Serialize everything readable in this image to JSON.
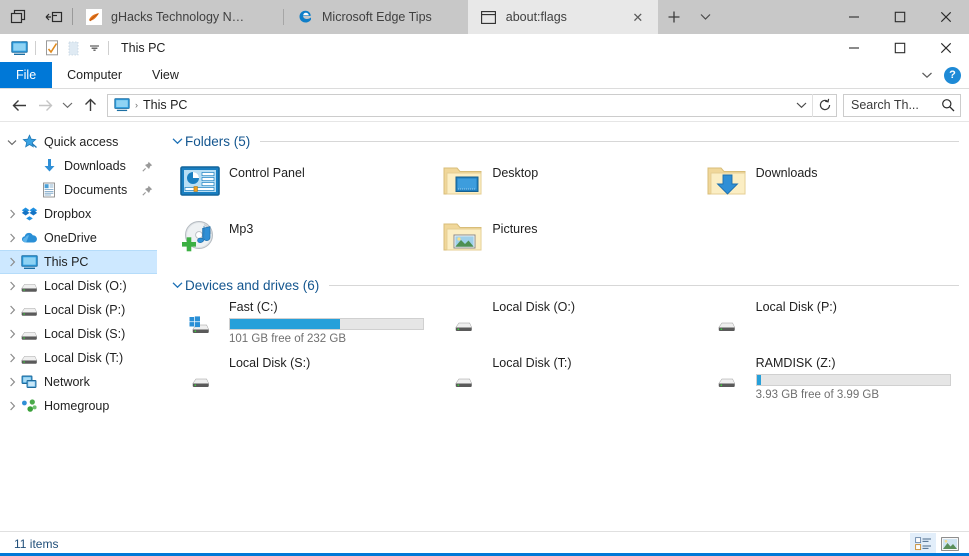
{
  "sets_tabs": {
    "left_buttons": [
      {
        "name": "tab-list-button",
        "icon": "tab-list-icon"
      },
      {
        "name": "restore-tabs-button",
        "icon": "restore-tabs-icon"
      }
    ],
    "tabs": [
      {
        "title": "gHacks Technology News",
        "icon": "ghacks-favicon",
        "active": false
      },
      {
        "title": "Microsoft Edge Tips",
        "icon": "edge-icon",
        "active": false
      },
      {
        "title": "about:flags",
        "icon": "window-icon",
        "active": true
      }
    ],
    "new_tab_label": "+",
    "tab_menu_label": "⌄",
    "window_controls": [
      "minimize",
      "maximize",
      "close"
    ]
  },
  "explorer_window": {
    "quick_access_toolbar": {
      "title": "This PC",
      "icons": [
        "this-pc-icon",
        "properties-icon",
        "new-folder-icon"
      ],
      "customize_label": "⌄"
    },
    "window_controls": [
      "minimize",
      "maximize",
      "close"
    ]
  },
  "ribbon": {
    "file_label": "File",
    "tabs": [
      "Computer",
      "View"
    ],
    "minimize_label": "⌄",
    "help_label": "?"
  },
  "address_bar": {
    "back_label": "←",
    "forward_label": "→",
    "recent_label": "⌄",
    "up_label": "↑",
    "path_icon": "this-pc-icon",
    "path_separator": "›",
    "path_text": "This PC",
    "dropdown_label": "⌄",
    "refresh_label": "↻",
    "search_value": "Search Th...",
    "search_placeholder": "Search This PC",
    "search_icon": "search-icon"
  },
  "sidebar": {
    "items": [
      {
        "label": "Quick access",
        "icon": "star-pin-icon",
        "expander": "⌄",
        "expanded": true,
        "child": false,
        "pinned": false,
        "selected": false
      },
      {
        "label": "Downloads",
        "icon": "downloads-icon",
        "expander": "",
        "child": true,
        "pinned": true,
        "selected": false
      },
      {
        "label": "Documents",
        "icon": "documents-icon",
        "expander": "",
        "child": true,
        "pinned": true,
        "selected": false
      },
      {
        "label": "Dropbox",
        "icon": "dropbox-icon",
        "expander": "›",
        "child": false,
        "pinned": false,
        "selected": false
      },
      {
        "label": "OneDrive",
        "icon": "onedrive-icon",
        "expander": "›",
        "child": false,
        "pinned": false,
        "selected": false
      },
      {
        "label": "This PC",
        "icon": "this-pc-icon",
        "expander": "›",
        "child": false,
        "pinned": false,
        "selected": true
      },
      {
        "label": "Local Disk (O:)",
        "icon": "drive-icon",
        "expander": "›",
        "child": false,
        "pinned": false,
        "selected": false
      },
      {
        "label": "Local Disk (P:)",
        "icon": "drive-icon",
        "expander": "›",
        "child": false,
        "pinned": false,
        "selected": false
      },
      {
        "label": "Local Disk (S:)",
        "icon": "drive-icon",
        "expander": "›",
        "child": false,
        "pinned": false,
        "selected": false
      },
      {
        "label": "Local Disk (T:)",
        "icon": "drive-icon",
        "expander": "›",
        "child": false,
        "pinned": false,
        "selected": false
      },
      {
        "label": "Network",
        "icon": "network-icon",
        "expander": "›",
        "child": false,
        "pinned": false,
        "selected": false
      },
      {
        "label": "Homegroup",
        "icon": "homegroup-icon",
        "expander": "›",
        "child": false,
        "pinned": false,
        "selected": false
      }
    ]
  },
  "content": {
    "groups": [
      {
        "title": "Folders (5)",
        "chevron": "⌄",
        "items": [
          {
            "name": "Control Panel",
            "icon": "control-panel-icon",
            "type": "folder"
          },
          {
            "name": "Desktop",
            "icon": "desktop-folder-icon",
            "type": "folder"
          },
          {
            "name": "Downloads",
            "icon": "downloads-folder-icon",
            "type": "folder"
          },
          {
            "name": "Mp3",
            "icon": "mp3-disc-icon",
            "type": "folder"
          },
          {
            "name": "Pictures",
            "icon": "pictures-folder-icon",
            "type": "folder"
          }
        ]
      },
      {
        "title": "Devices and drives (6)",
        "chevron": "⌄",
        "items": [
          {
            "name": "Fast (C:)",
            "icon": "windows-drive-icon",
            "type": "drive",
            "has_bar": true,
            "used_percent": 57,
            "capacity_text": "101 GB free of 232 GB"
          },
          {
            "name": "Local Disk (O:)",
            "icon": "drive-icon",
            "type": "drive",
            "has_bar": false,
            "capacity_text": ""
          },
          {
            "name": "Local Disk (P:)",
            "icon": "drive-icon",
            "type": "drive",
            "has_bar": false,
            "capacity_text": ""
          },
          {
            "name": "Local Disk (S:)",
            "icon": "drive-icon",
            "type": "drive",
            "has_bar": false,
            "capacity_text": ""
          },
          {
            "name": "Local Disk (T:)",
            "icon": "drive-icon",
            "type": "drive",
            "has_bar": false,
            "capacity_text": ""
          },
          {
            "name": "RAMDISK (Z:)",
            "icon": "drive-icon",
            "type": "drive",
            "has_bar": true,
            "used_percent": 2,
            "capacity_text": "3.93 GB free of 3.99 GB"
          }
        ]
      }
    ]
  },
  "status_bar": {
    "item_count": "11 items",
    "view_buttons": [
      {
        "name": "details-view-button",
        "icon": "details-view-icon",
        "active": true
      },
      {
        "name": "large-icons-view-button",
        "icon": "large-icons-view-icon",
        "active": false
      }
    ]
  },
  "colors": {
    "accent": "#0078d7",
    "tabstrip_bg": "#c8c8c8",
    "active_tab_bg": "#e8e8e8",
    "selection": "#cde8ff",
    "group_header": "#14568f",
    "progress_fill": "#26a0da"
  }
}
